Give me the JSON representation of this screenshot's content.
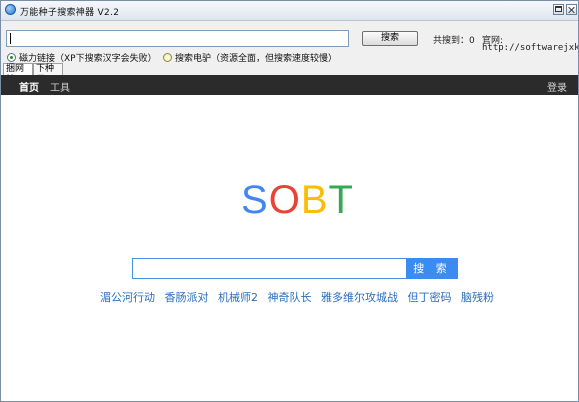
{
  "window": {
    "title": "万能种子搜索神器 V2.2"
  },
  "toolbar": {
    "search_value": "",
    "search_button": "搜索",
    "count_label": "共搜到：0",
    "site_label": "官网:",
    "site_url": "http://softwarejxk.com",
    "radio_options": [
      {
        "label": "磁力链接（XP下搜索汉字会失败）",
        "selected": true
      },
      {
        "label": "搜索电驴（资源全面，但搜索速度较慢）",
        "selected": false
      }
    ]
  },
  "tabs": [
    {
      "label": "捆网站",
      "active": true
    },
    {
      "label": "下种子",
      "active": false
    }
  ],
  "web": {
    "nav": [
      {
        "label": "首页",
        "active": true
      },
      {
        "label": "工具",
        "active": false
      }
    ],
    "login": "登录",
    "logo_letters": [
      {
        "char": "S",
        "color": "#4285f4"
      },
      {
        "char": "O",
        "color": "#ea4335"
      },
      {
        "char": "B",
        "color": "#fbbc05"
      },
      {
        "char": "T",
        "color": "#34a853"
      }
    ],
    "search_placeholder": "",
    "search_button": "搜 索",
    "hot_links": [
      "湄公河行动",
      "香肠派对",
      "机械师2",
      "神奇队长",
      "雅多维尔攻城战",
      "但丁密码",
      "脑残粉"
    ]
  }
}
